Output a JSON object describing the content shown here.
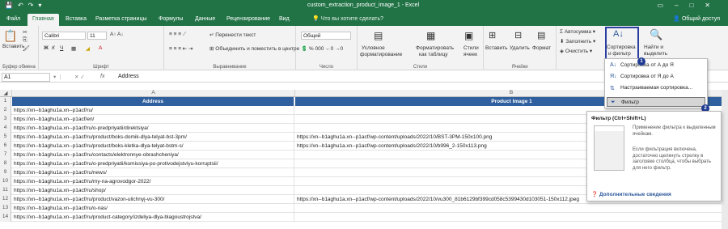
{
  "window": {
    "title": "custom_extraction_product_image_1 - Excel",
    "tell_me": "Что вы хотите сделать?",
    "share": "Общий доступ"
  },
  "tabs": [
    "Файл",
    "Главная",
    "Вставка",
    "Разметка страницы",
    "Формулы",
    "Данные",
    "Рецензирование",
    "Вид"
  ],
  "ribbon": {
    "paste": "Вставить",
    "clipboard": "Буфер обмена",
    "font_name": "Calibri",
    "font_size": "11",
    "font_group": "Шрифт",
    "wrap_text": "Перенести текст",
    "merge_center": "Объединить и поместить в центре",
    "alignment_group": "Выравнивание",
    "number_format": "Общий",
    "number_group": "Число",
    "cond_format_1": "Условное",
    "cond_format_2": "форматирование",
    "format_table_1": "Форматировать",
    "format_table_2": "как таблицу",
    "cell_styles_1": "Стили",
    "cell_styles_2": "ячеек",
    "styles_group": "Стили",
    "insert": "Вставить",
    "delete": "Удалить",
    "format": "Формат",
    "cells_group": "Ячейки",
    "autosum": "Автосумма",
    "fill": "Заполнить",
    "clear": "Очистить",
    "sort_filter_1": "Сортировка",
    "sort_filter_2": "и фильтр",
    "find_1": "Найти и",
    "find_2": "выделить",
    "editing_group": "Редакт"
  },
  "formula_bar": {
    "cell_ref": "A1",
    "fx": "fx",
    "content": "Address"
  },
  "columns": [
    "A",
    "B"
  ],
  "rows": [
    {
      "num": "1",
      "a": "Address",
      "b": "Product Image 1"
    },
    {
      "num": "2",
      "a": "https://xn--b1aghu1a.xn--p1acf/ru/",
      "b": ""
    },
    {
      "num": "3",
      "a": "https://xn--b1aghu1a.xn--p1acf/en/",
      "b": ""
    },
    {
      "num": "4",
      "a": "https://xn--b1aghu1a.xn--p1acf/ru/o-predpriyatii/direktsiya/",
      "b": ""
    },
    {
      "num": "5",
      "a": "https://xn--b1aghu1a.xn--p1acf/ru/product/boks-domik-dlya-telyat-bst-3pm/",
      "b": "https://xn--b1aghu1a.xn--p1acf/wp-content/uploads/2022/10/BST-3PM-150x100.png"
    },
    {
      "num": "6",
      "a": "https://xn--b1aghu1a.xn--p1acf/ru/product/boks-kletka-dlya-telyat-bstm-s/",
      "b": "https://xn--b1aghu1a.xn--p1acf/wp-content/uploads/2022/10/b996_2-150x113.png"
    },
    {
      "num": "7",
      "a": "https://xn--b1aghu1a.xn--p1acf/ru/contacts/elektronnye-obrashcheniya/",
      "b": ""
    },
    {
      "num": "8",
      "a": "https://xn--b1aghu1a.xn--p1acf/ru/o-predpriyatii/komissiya-po-protivodejstviyu-korruptsii/",
      "b": ""
    },
    {
      "num": "9",
      "a": "https://xn--b1aghu1a.xn--p1acf/ru/news/",
      "b": ""
    },
    {
      "num": "10",
      "a": "https://xn--b1aghu1a.xn--p1acf/ru/my-na-agrovodgor-2022/",
      "b": ""
    },
    {
      "num": "11",
      "a": "https://xn--b1aghu1a.xn--p1acf/ru/shop/",
      "b": ""
    },
    {
      "num": "12",
      "a": "https://xn--b1aghu1a.xn--p1acf/ru/product/vazon-ulichnyj-vu-300/",
      "b": "https://xn--b1aghu1a.xn--p1acf/wp-content/uploads/2022/10/vu300_81b6129bf399cd058c5399430d103051-150x112.jpeg"
    },
    {
      "num": "13",
      "a": "https://xn--b1aghu1a.xn--p1acf/ru/o-nas/",
      "b": ""
    },
    {
      "num": "14",
      "a": "https://xn--b1aghu1a.xn--p1acf/ru/product-category/izdeliya-dlya-blagoustrojstva/",
      "b": ""
    }
  ],
  "sort_menu": {
    "items": [
      "Сортировка от А до Я",
      "Сортировка от Я до А",
      "Настраиваемая сортировка...",
      "Фильтр"
    ],
    "badge_1": "1",
    "badge_2": "2"
  },
  "tooltip": {
    "title": "Фильтр (Ctrl+Shift+L)",
    "text_1": "Применение фильтра к выделенным ячейкам.",
    "text_2": "Если фильтрация включена, достаточно щелкнуть стрелку в заголовке столбца, чтобы выбрать для него фильтр.",
    "link": "Дополнительные сведения"
  },
  "colors": {
    "excel_green": "#217346",
    "header_blue": "#2f5f9e",
    "highlight_box": "#2b3ea0"
  }
}
